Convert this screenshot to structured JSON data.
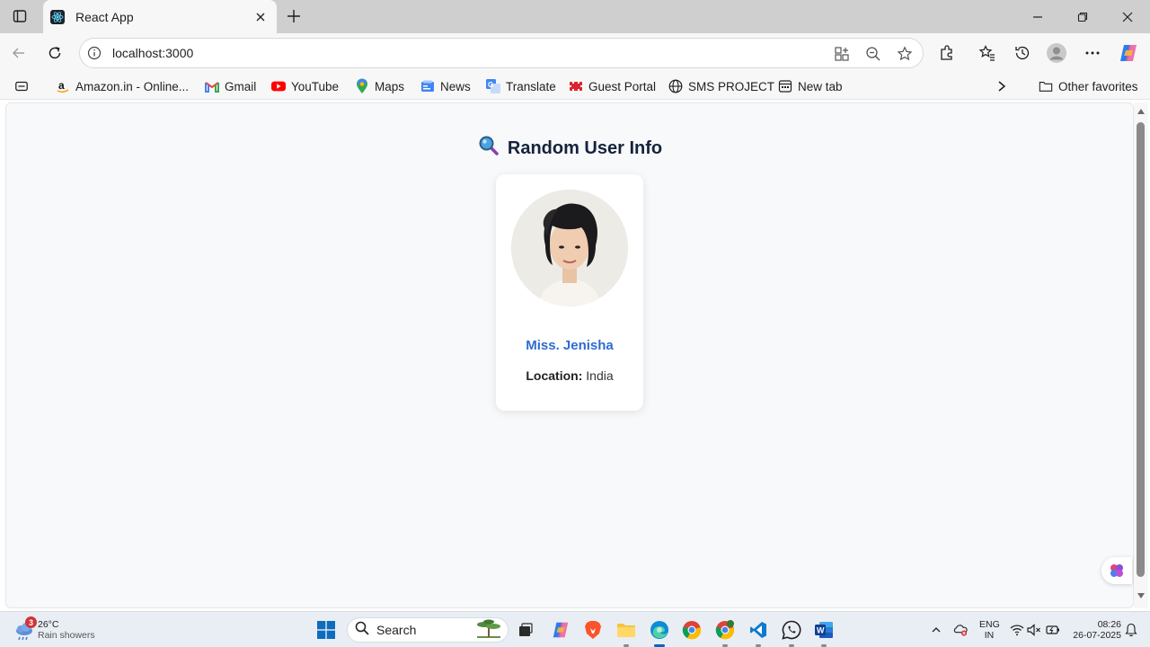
{
  "browser": {
    "tab": {
      "title": "React App"
    },
    "address": {
      "url": "localhost:3000"
    },
    "bookmarks": [
      {
        "label": "Amazon.in - Online...",
        "icon": "amazon-icon"
      },
      {
        "label": "Gmail",
        "icon": "gmail-icon"
      },
      {
        "label": "YouTube",
        "icon": "youtube-icon"
      },
      {
        "label": "Maps",
        "icon": "maps-icon"
      },
      {
        "label": "News",
        "icon": "news-icon"
      },
      {
        "label": "Translate",
        "icon": "translate-icon"
      },
      {
        "label": "Guest Portal",
        "icon": "guest-portal-icon"
      },
      {
        "label": "SMS PROJECT",
        "icon": "globe-icon"
      },
      {
        "label": "New tab",
        "icon": "new-tab-icon"
      }
    ],
    "other_favorites": "Other favorites"
  },
  "page": {
    "heading": "Random User Info",
    "heading_icon": "magnifier-icon",
    "user": {
      "name": "Miss. Jenisha",
      "location_label": "Location:",
      "location": "India"
    }
  },
  "taskbar": {
    "weather": {
      "badge": "3",
      "temp": "26°C",
      "condition": "Rain showers"
    },
    "search_label": "Search",
    "language": {
      "line1": "ENG",
      "line2": "IN"
    },
    "clock": {
      "time": "08:26",
      "date": "26-07-2025"
    }
  },
  "colors": {
    "accent_name": "#2f6bd1",
    "heading": "#15233b",
    "page_bg": "#f8f9fb"
  }
}
